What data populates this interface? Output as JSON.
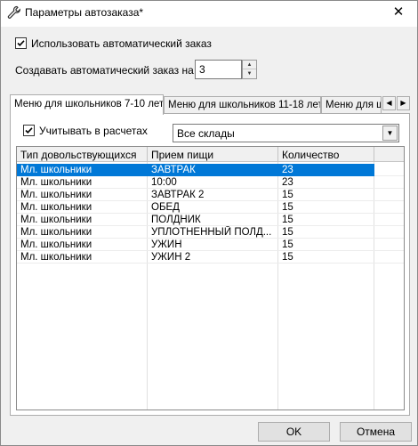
{
  "window": {
    "title": "Параметры автозаказа*",
    "close": "✕"
  },
  "options": {
    "use_auto_label": "Использовать автоматический заказ",
    "use_auto_checked": true,
    "create_label": "Создавать автоматический заказ на:",
    "create_value": "3"
  },
  "tabs": [
    {
      "label": "Меню для школьников 7-10 лет",
      "active": true
    },
    {
      "label": "Меню для школьников 11-18 лет",
      "active": false
    },
    {
      "label": "Меню для ш",
      "active": false
    }
  ],
  "panel": {
    "consider_label": "Учитывать в расчетах",
    "consider_checked": true,
    "warehouse_value": "Все склады"
  },
  "grid": {
    "columns": [
      "Тип довольствующихся",
      "Прием пищи",
      "Количество"
    ],
    "rows": [
      [
        "Мл. школьники",
        "ЗАВТРАК",
        "23"
      ],
      [
        "Мл. школьники",
        "10:00",
        "23"
      ],
      [
        "Мл. школьники",
        "ЗАВТРАК 2",
        "15"
      ],
      [
        "Мл. школьники",
        "ОБЕД",
        "15"
      ],
      [
        "Мл. школьники",
        "ПОЛДНИК",
        "15"
      ],
      [
        "Мл. школьники",
        "УПЛОТНЕННЫЙ ПОЛД...",
        "15"
      ],
      [
        "Мл. школьники",
        "УЖИН",
        "15"
      ],
      [
        "Мл. школьники",
        "УЖИН 2",
        "15"
      ]
    ],
    "selected_row": 0
  },
  "buttons": {
    "ok": "OK",
    "cancel": "Отмена"
  },
  "colors": {
    "selection": "#0078d7",
    "panel": "#f0f0f0"
  }
}
